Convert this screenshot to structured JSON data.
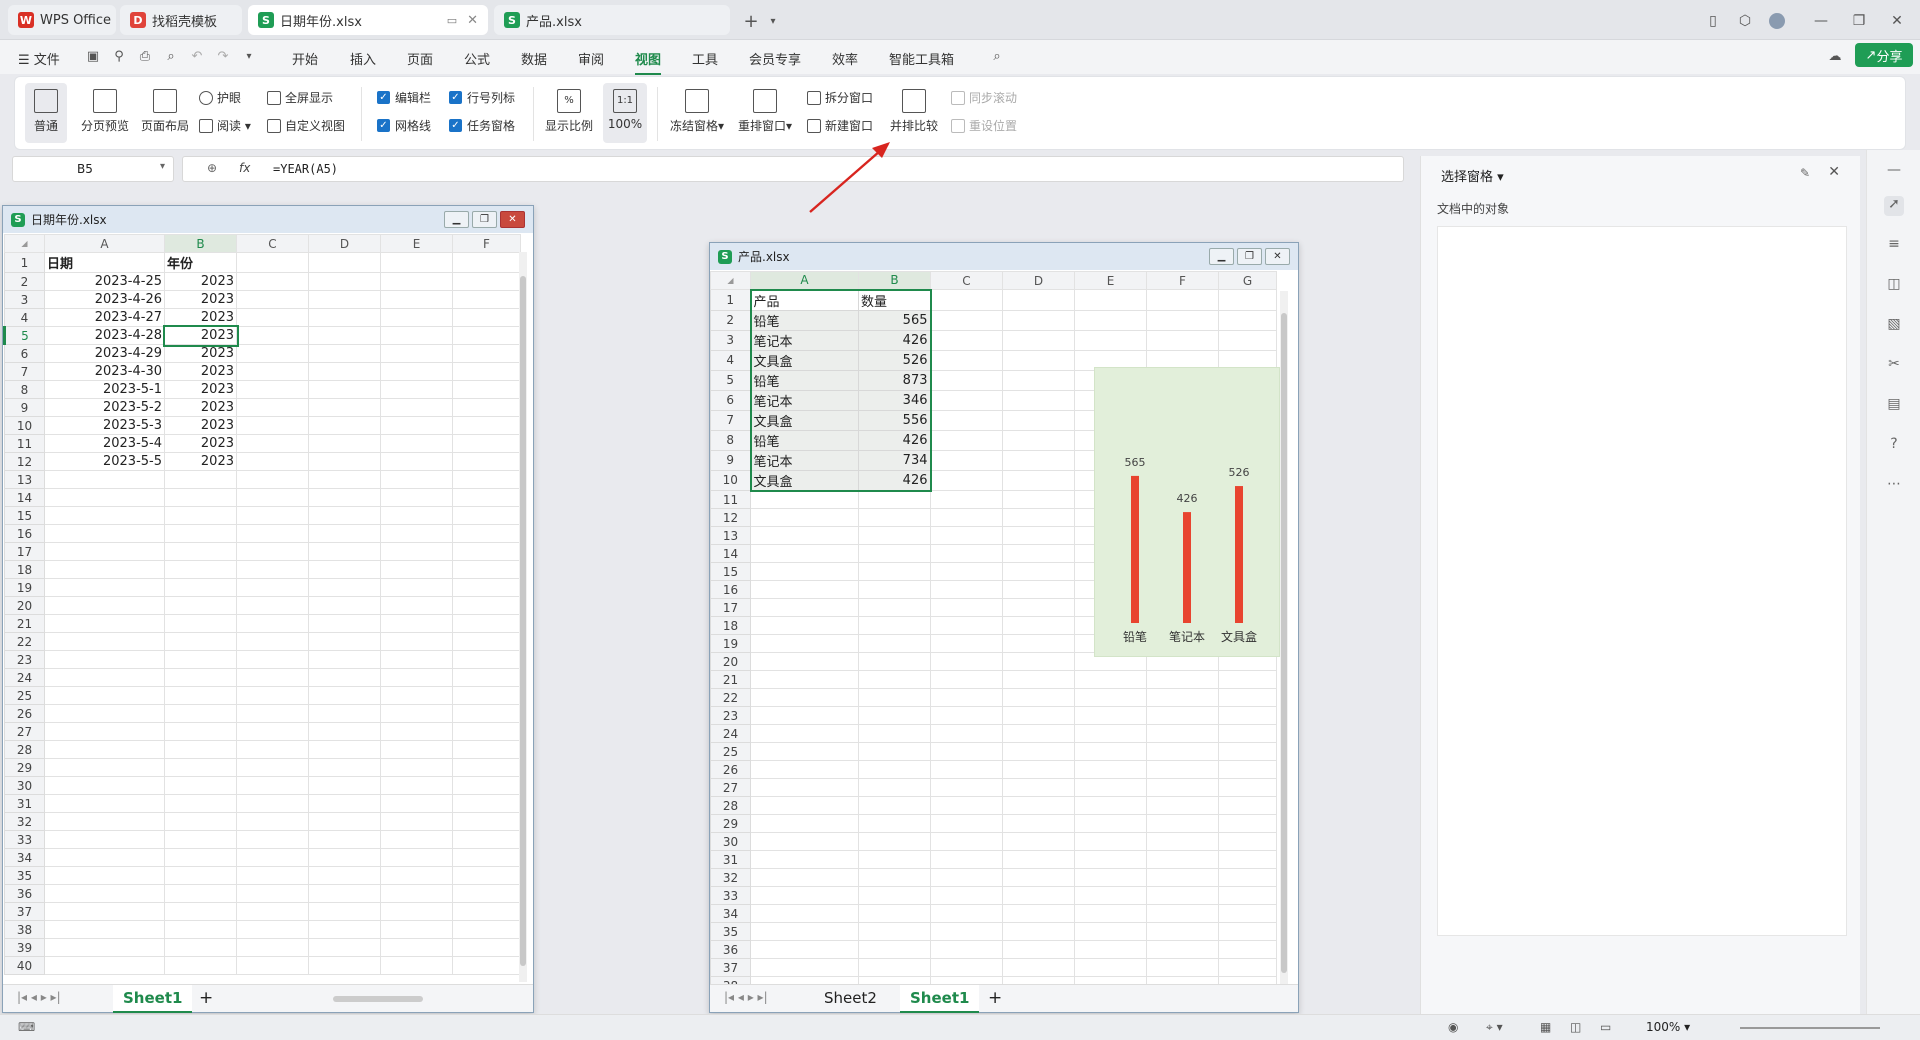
{
  "titlebar": {
    "tabs": [
      {
        "label": "WPS Office",
        "icon": "wps-logo-icon"
      },
      {
        "label": "找稻壳模板",
        "icon": "docer-icon"
      },
      {
        "label": "日期年份.xlsx",
        "icon": "sheet-icon"
      },
      {
        "label": "产品.xlsx",
        "icon": "sheet-icon"
      }
    ],
    "new_tab": "+"
  },
  "menubar": {
    "file": "文件",
    "items": [
      "开始",
      "插入",
      "页面",
      "公式",
      "数据",
      "审阅",
      "视图",
      "工具",
      "会员专享",
      "效率",
      "智能工具箱"
    ],
    "active": "视图",
    "share": "分享"
  },
  "ribbon": {
    "normal": "普通",
    "page_break": "分页预览",
    "page_layout": "页面布局",
    "eye_protect": "护眼",
    "reading": "阅读",
    "fullscreen": "全屏显示",
    "custom_view": "自定义视图",
    "edit_bar": "编辑栏",
    "gridlines": "网格线",
    "row_col_headers": "行号列标",
    "task_pane": "任务窗格",
    "zoom": "显示比例",
    "zoom_100": "100%",
    "zoom_100_icon": "1:1",
    "freeze": "冻结窗格",
    "arrange": "重排窗口",
    "split": "拆分窗口",
    "new_window": "新建窗口",
    "side_by_side": "并排比较",
    "sync_scroll": "同步滚动",
    "reset_pos": "重设位置"
  },
  "formula": {
    "cell": "B5",
    "fx": "fx",
    "content": "=YEAR(A5)"
  },
  "win1": {
    "title": "日期年份.xlsx",
    "cols": [
      "A",
      "B",
      "C",
      "D",
      "E",
      "F"
    ],
    "header": [
      "日期",
      "年份"
    ],
    "rows": [
      [
        "2023-4-25",
        "2023"
      ],
      [
        "2023-4-26",
        "2023"
      ],
      [
        "2023-4-27",
        "2023"
      ],
      [
        "2023-4-28",
        "2023"
      ],
      [
        "2023-4-29",
        "2023"
      ],
      [
        "2023-4-30",
        "2023"
      ],
      [
        "2023-5-1",
        "2023"
      ],
      [
        "2023-5-2",
        "2023"
      ],
      [
        "2023-5-3",
        "2023"
      ],
      [
        "2023-5-4",
        "2023"
      ],
      [
        "2023-5-5",
        "2023"
      ]
    ],
    "sheet": "Sheet1"
  },
  "win2": {
    "title": "产品.xlsx",
    "cols": [
      "A",
      "B",
      "C",
      "D",
      "E",
      "F",
      "G"
    ],
    "header": [
      "产品",
      "数量"
    ],
    "rows": [
      [
        "铅笔",
        "565"
      ],
      [
        "笔记本",
        "426"
      ],
      [
        "文具盒",
        "526"
      ],
      [
        "铅笔",
        "873"
      ],
      [
        "笔记本",
        "346"
      ],
      [
        "文具盒",
        "556"
      ],
      [
        "铅笔",
        "426"
      ],
      [
        "笔记本",
        "734"
      ],
      [
        "文具盒",
        "426"
      ]
    ],
    "sheets": [
      "Sheet2",
      "Sheet1"
    ]
  },
  "chart_data": {
    "type": "bar",
    "categories": [
      "铅笔",
      "笔记本",
      "文具盒"
    ],
    "values": [
      565,
      426,
      526
    ],
    "ylim": [
      0,
      700
    ],
    "bar_color": "#e8442f",
    "bg_color": "#e2efda"
  },
  "selpane": {
    "title": "选择窗格",
    "subtitle": "文档中的对象"
  },
  "status": {
    "zoom": "100%"
  },
  "colors": {
    "accent": "#1f8a4c",
    "share": "#1f9d55",
    "checkbox": "#1a73c8"
  }
}
